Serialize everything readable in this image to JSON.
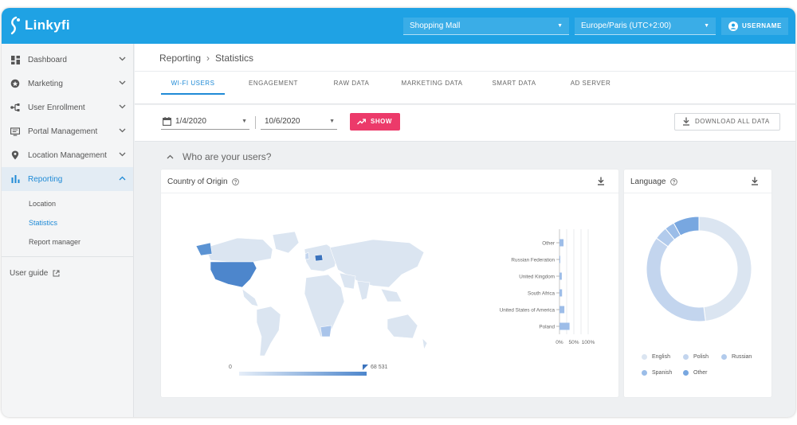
{
  "header": {
    "logo_text": "Linkyfi",
    "venue_select": "Shopping Mall",
    "timezone_select": "Europe/Paris (UTC+2:00)",
    "username_label": "USERNAME"
  },
  "sidebar": {
    "items": [
      {
        "label": "Dashboard",
        "icon": "dashboard-icon"
      },
      {
        "label": "Marketing",
        "icon": "marketing-icon"
      },
      {
        "label": "User Enrollment",
        "icon": "user-enrollment-icon"
      },
      {
        "label": "Portal Management",
        "icon": "portal-icon"
      },
      {
        "label": "Location Management",
        "icon": "location-pin-icon"
      },
      {
        "label": "Reporting",
        "icon": "bar-chart-icon",
        "active": true
      }
    ],
    "sub_items": [
      {
        "label": "Location"
      },
      {
        "label": "Statistics",
        "active": true
      },
      {
        "label": "Report manager"
      }
    ],
    "user_guide": "User guide"
  },
  "breadcrumb": {
    "parent": "Reporting",
    "current": "Statistics"
  },
  "tabs": [
    {
      "label": "WI-FI USERS",
      "active": true
    },
    {
      "label": "ENGAGEMENT"
    },
    {
      "label": "RAW DATA"
    },
    {
      "label": "MARKETING DATA"
    },
    {
      "label": "SMART DATA"
    },
    {
      "label": "AD SERVER"
    }
  ],
  "filters": {
    "date_from": "1/4/2020",
    "date_to": "10/6/2020",
    "show_label": "SHOW",
    "download_all_label": "DOWNLOAD ALL DATA"
  },
  "section": {
    "title": "Who are your users?"
  },
  "colors": {
    "brand": "#1fa2e4",
    "accent": "#ec3a6a",
    "active_text": "#1f8ad6",
    "map_base": "#dbe5f1",
    "map_high": "#5b93d3",
    "bar": "#9dbde8"
  },
  "cards": {
    "country": {
      "title": "Country of Origin",
      "scale_min": "0",
      "scale_max": "68 531"
    },
    "language": {
      "title": "Language"
    }
  },
  "chart_data": [
    {
      "type": "bar",
      "orientation": "horizontal",
      "categories": [
        "Other",
        "Russian Federation",
        "United Kingdom",
        "South Africa",
        "United States of America",
        "Poland"
      ],
      "values": [
        14,
        2,
        8,
        9,
        17,
        35
      ],
      "xlim": [
        0,
        100
      ],
      "x_ticks": [
        "0%",
        "50%",
        "100%"
      ],
      "grid": true
    },
    {
      "type": "pie",
      "donut": true,
      "labels": [
        "English",
        "Polish",
        "Russian",
        "Spanish",
        "Other"
      ],
      "values": [
        48,
        37,
        4,
        3,
        8
      ],
      "colors": [
        "#dbe5f1",
        "#c3d5ee",
        "#b2cbec",
        "#9bbde8",
        "#78a7e0"
      ],
      "legend": "bottom"
    }
  ]
}
